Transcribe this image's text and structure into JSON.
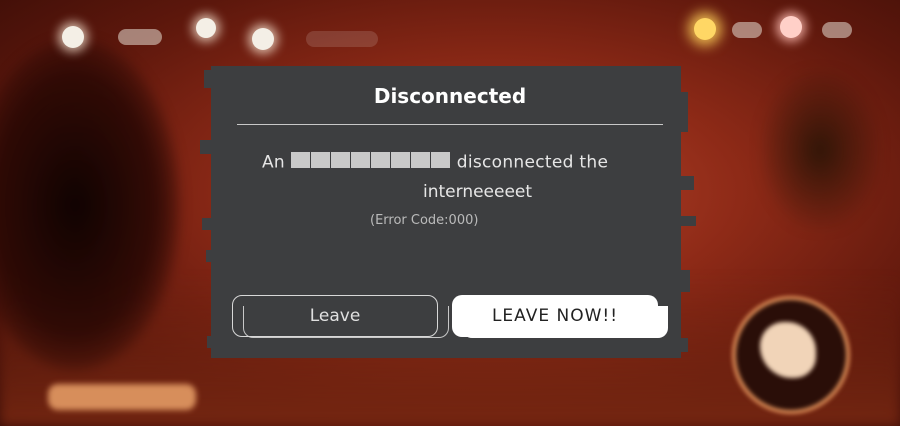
{
  "dialog": {
    "title": "Disconnected",
    "message_prefix": "An",
    "message_suffix": "disconnected the",
    "message_line2": "interneeeeet",
    "error_code": "(Error Code:000)"
  },
  "buttons": {
    "leave_label": "Leave",
    "leave_now_label": "LEAVE NOW!!"
  },
  "colors": {
    "dialog_bg": "#3d3e40",
    "primary_button_bg": "#ffffff",
    "background_accent": "#8e2a17"
  },
  "icons": [
    "hud-avatar-icon",
    "hud-resource-icon",
    "action-button-icon"
  ]
}
